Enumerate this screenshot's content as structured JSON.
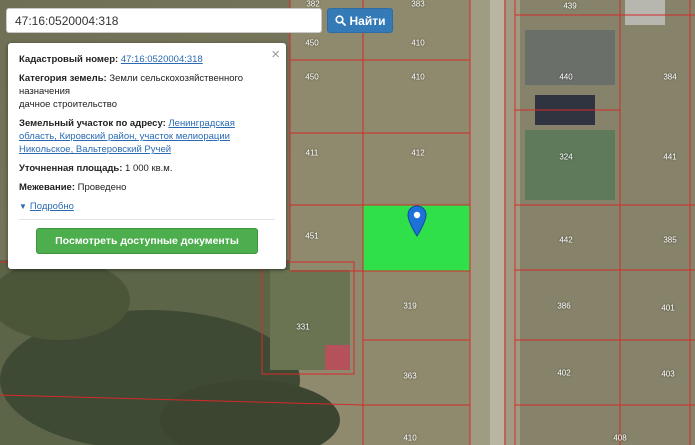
{
  "search": {
    "value": "47:16:0520004:318",
    "button_label": "Найти",
    "button_icon": "search-icon"
  },
  "popup": {
    "cadastral_label": "Кадастровый номер:",
    "cadastral_value": "47:16:0520004:318",
    "category_label": "Категория земель:",
    "category_value_line1": "Земли сельскохозяйственного",
    "category_value_line2": "назначения",
    "category_value_line3": "дачное строительство",
    "address_label": "Земельный участок по адресу:",
    "address_line1": "Ленинградская",
    "address_line2": "область, Кировский район, участок мелиорации",
    "address_line3": "Никольское, Вальтеровский Ручей",
    "area_label": "Уточненная площадь:",
    "area_value": "1 000 кв.м.",
    "survey_label": "Межевание:",
    "survey_value": "Проведено",
    "details_link": "Подробно",
    "docs_button": "Посмотреть доступные документы",
    "close_icon": "close-icon"
  },
  "map": {
    "parcel_labels": [
      "382",
      "383",
      "439",
      "450",
      "410",
      "440",
      "384",
      "450",
      "410",
      "411",
      "412",
      "324",
      "441",
      "451",
      "442",
      "385",
      "331",
      "319",
      "386",
      "401",
      "363",
      "402",
      "403",
      "410",
      "408"
    ],
    "highlight_color": "#2fe04a",
    "boundary_color": "#d42a2a",
    "pin_color": "#1d72d8"
  }
}
